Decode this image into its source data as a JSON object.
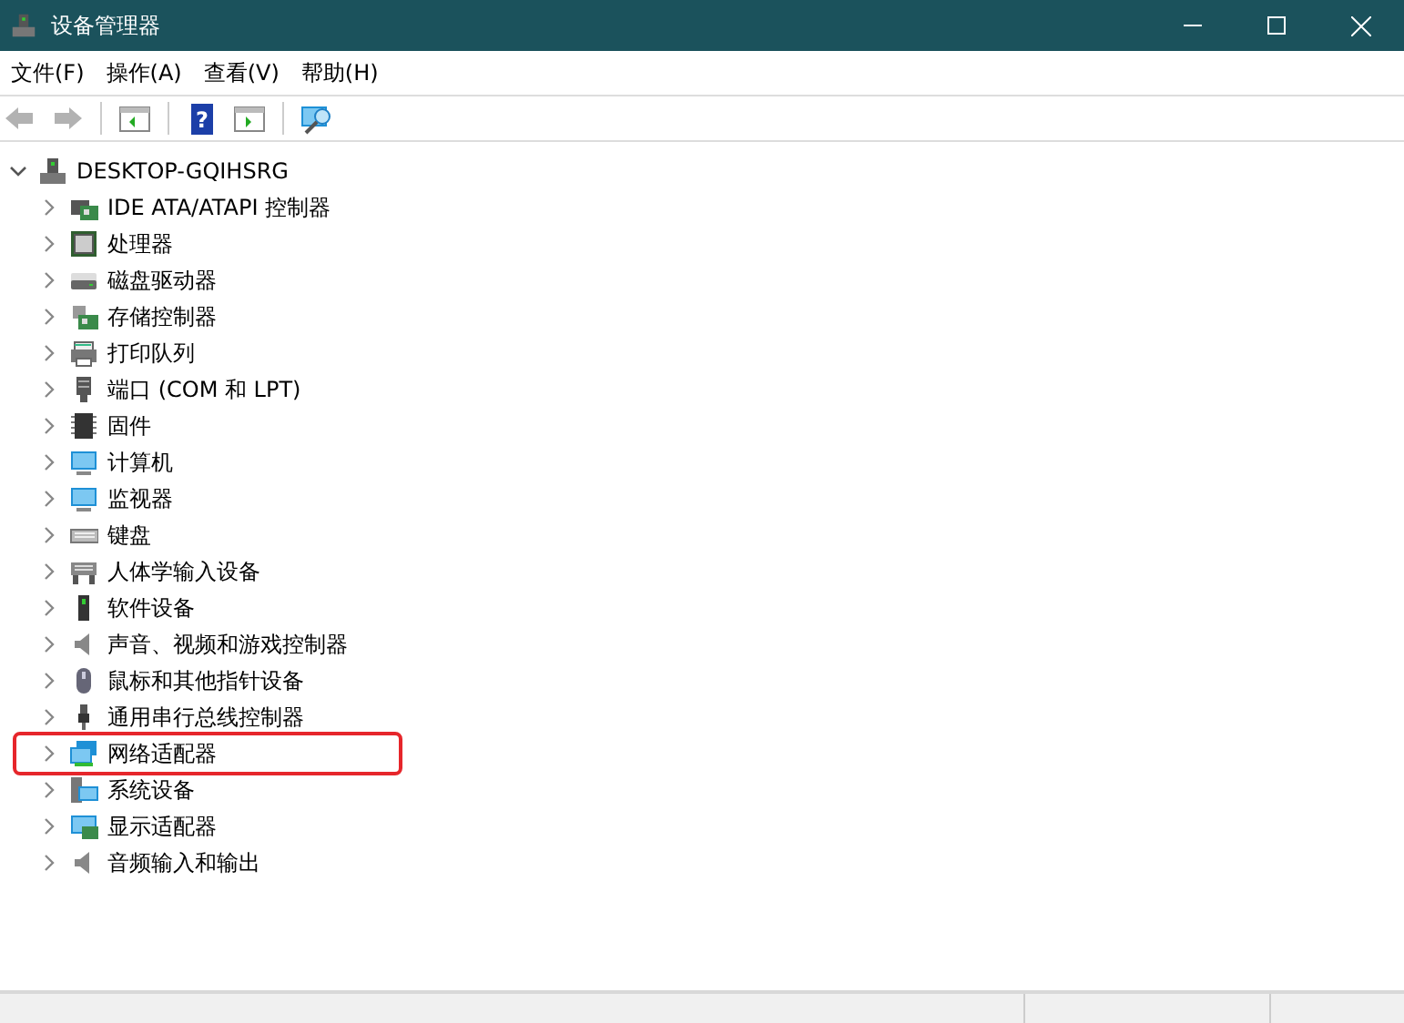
{
  "window": {
    "title": "设备管理器"
  },
  "menu": [
    "文件(F)",
    "操作(A)",
    "查看(V)",
    "帮助(H)"
  ],
  "toolbar": [
    {
      "kind": "back",
      "disabled": true
    },
    {
      "kind": "forward",
      "disabled": true
    },
    {
      "kind": "sep"
    },
    {
      "kind": "console"
    },
    {
      "kind": "sep"
    },
    {
      "kind": "help",
      "glyph": "?"
    },
    {
      "kind": "action"
    },
    {
      "kind": "sep"
    },
    {
      "kind": "scan"
    }
  ],
  "tree": {
    "label": "DESKTOP-GQIHSRG",
    "expanded": true,
    "children": [
      {
        "label": "IDE ATA/ATAPI 控制器",
        "kind": "controller",
        "expanded": false,
        "annotated": false
      },
      {
        "label": "处理器",
        "kind": "cpu",
        "expanded": false,
        "annotated": false
      },
      {
        "label": "磁盘驱动器",
        "kind": "disk",
        "expanded": false,
        "annotated": false
      },
      {
        "label": "存储控制器",
        "kind": "storage",
        "expanded": false,
        "annotated": false
      },
      {
        "label": "打印队列",
        "kind": "printer",
        "expanded": false,
        "annotated": false
      },
      {
        "label": "端口 (COM 和 LPT)",
        "kind": "port",
        "expanded": false,
        "annotated": false
      },
      {
        "label": "固件",
        "kind": "chip",
        "expanded": false,
        "annotated": false
      },
      {
        "label": "计算机",
        "kind": "monitor",
        "expanded": false,
        "annotated": false
      },
      {
        "label": "监视器",
        "kind": "monitor",
        "expanded": false,
        "annotated": false
      },
      {
        "label": "键盘",
        "kind": "keyboard",
        "expanded": false,
        "annotated": false
      },
      {
        "label": "人体学输入设备",
        "kind": "hid",
        "expanded": false,
        "annotated": false
      },
      {
        "label": "软件设备",
        "kind": "software",
        "expanded": false,
        "annotated": false
      },
      {
        "label": "声音、视频和游戏控制器",
        "kind": "speaker",
        "expanded": false,
        "annotated": false
      },
      {
        "label": "鼠标和其他指针设备",
        "kind": "mouse",
        "expanded": false,
        "annotated": false
      },
      {
        "label": "通用串行总线控制器",
        "kind": "usb",
        "expanded": false,
        "annotated": false
      },
      {
        "label": "网络适配器",
        "kind": "network",
        "expanded": false,
        "annotated": true
      },
      {
        "label": "系统设备",
        "kind": "system",
        "expanded": false,
        "annotated": false
      },
      {
        "label": "显示适配器",
        "kind": "display",
        "expanded": false,
        "annotated": false
      },
      {
        "label": "音频输入和输出",
        "kind": "speaker",
        "expanded": false,
        "annotated": false
      }
    ]
  }
}
